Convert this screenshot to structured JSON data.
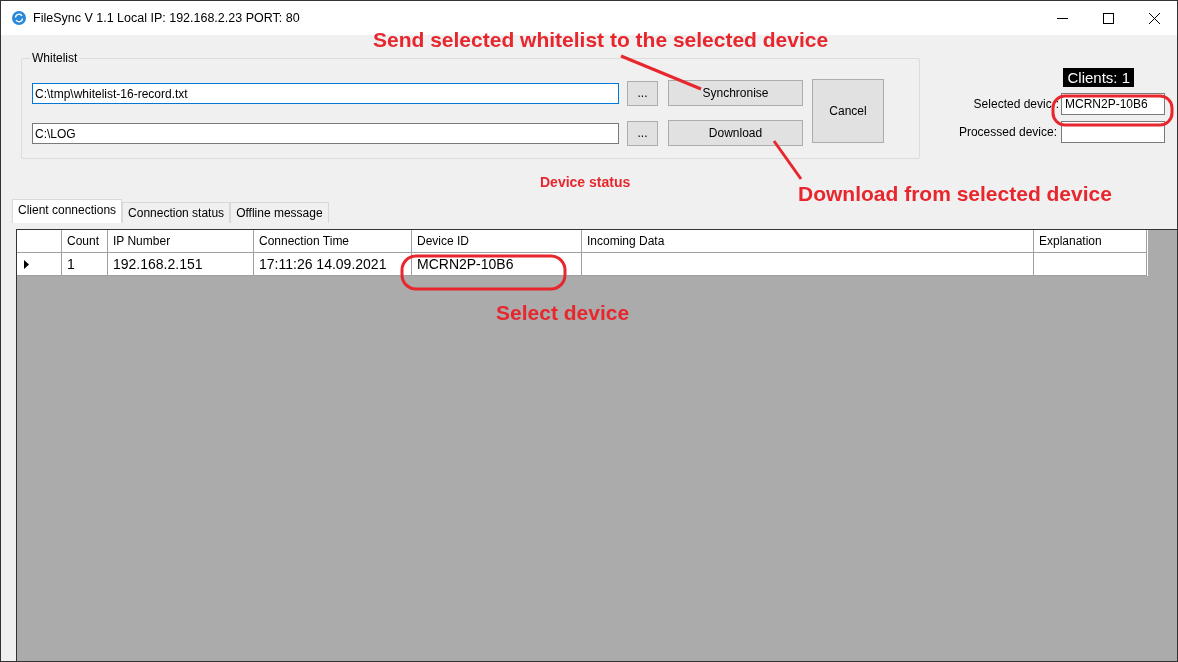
{
  "window": {
    "title": "FileSync V 1.1  Local IP: 192.168.2.23  PORT: 80"
  },
  "whitelist": {
    "label": "Whitelist",
    "rows": [
      {
        "path": "C:\\tmp\\whitelist-16-record.txt",
        "focused": true,
        "browse": "...",
        "action": "Synchronise"
      },
      {
        "path": "C:\\LOG",
        "focused": false,
        "browse": "...",
        "action": "Download"
      }
    ],
    "cancel": "Cancel"
  },
  "clients": "Clients: 1",
  "selected_device": {
    "label": "Selected devic",
    "colon": ":",
    "value": "MCRN2P-10B6"
  },
  "processed_device": {
    "label": "Processed device:"
  },
  "device_status": "Device status",
  "tabs": [
    {
      "label": "Client connections",
      "selected": true
    },
    {
      "label": "Connection status",
      "selected": false
    },
    {
      "label": "Offline message",
      "selected": false
    }
  ],
  "table": {
    "columns": [
      "Count",
      "IP Number",
      "Connection Time",
      "Device ID",
      "Incoming Data",
      "Explanation"
    ],
    "rows": [
      {
        "current": true,
        "cells": [
          "1",
          "192.168.2.151",
          "17:11:26 14.09.2021",
          "MCRN2P-10B6",
          null,
          null
        ]
      }
    ]
  },
  "annotations": [
    {
      "text": "Send selected whitelist to the selected device"
    },
    {
      "text": "Download from selected device"
    },
    {
      "text": "Select device"
    }
  ]
}
